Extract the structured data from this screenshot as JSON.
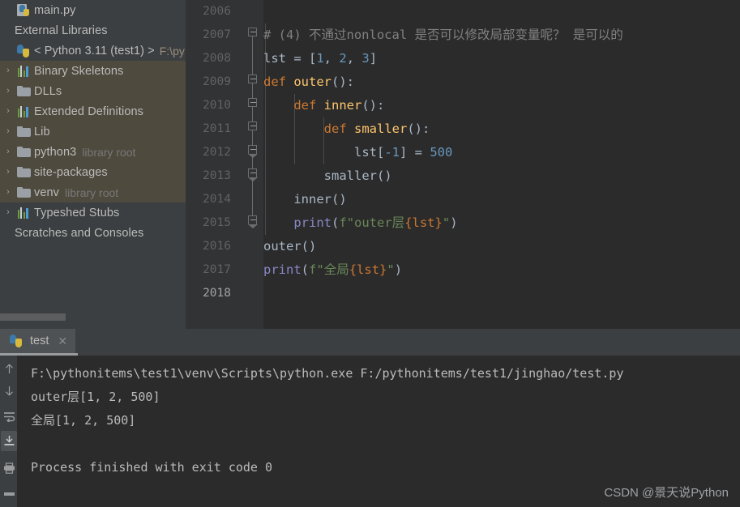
{
  "project_panel": {
    "items": [
      {
        "arrow": "",
        "icon": "python-file-icon",
        "label": "main.py",
        "suffix": "",
        "selected": false,
        "indent": 0
      },
      {
        "arrow": "",
        "icon": "none",
        "label": "External Libraries",
        "suffix": "",
        "selected": false,
        "indent": 0
      },
      {
        "arrow": "",
        "icon": "python-icon",
        "label": "< Python 3.11 (test1) >",
        "suffix": "F:\\py",
        "selected": false,
        "indent": 0
      },
      {
        "arrow": "›",
        "icon": "bars-icon",
        "label": "Binary Skeletons",
        "suffix": "",
        "selected": true,
        "indent": 1
      },
      {
        "arrow": "›",
        "icon": "folder-icon",
        "label": "DLLs",
        "suffix": "",
        "selected": true,
        "indent": 1
      },
      {
        "arrow": "›",
        "icon": "bars-icon",
        "label": "Extended Definitions",
        "suffix": "",
        "selected": true,
        "indent": 1
      },
      {
        "arrow": "›",
        "icon": "folder-icon",
        "label": "Lib",
        "suffix": "",
        "selected": true,
        "indent": 1
      },
      {
        "arrow": "›",
        "icon": "folder-icon",
        "label": "python3",
        "suffix": "library root",
        "selected": true,
        "indent": 1
      },
      {
        "arrow": "›",
        "icon": "folder-icon",
        "label": "site-packages",
        "suffix": "",
        "selected": true,
        "indent": 1
      },
      {
        "arrow": "›",
        "icon": "folder-icon",
        "label": "venv",
        "suffix": "library root",
        "selected": true,
        "indent": 1
      },
      {
        "arrow": "›",
        "icon": "bars-icon",
        "label": "Typeshed Stubs",
        "suffix": "",
        "selected": false,
        "indent": 1
      },
      {
        "arrow": "",
        "icon": "none",
        "label": "Scratches and Consoles",
        "suffix": "",
        "selected": false,
        "indent": 0
      }
    ]
  },
  "editor": {
    "first_line_number": 2006,
    "current_line_number": 2018,
    "lines": [
      {
        "n": "2006",
        "text": ""
      },
      {
        "n": "2007",
        "text": "# (4) 不通过nonlocal 是否可以修改局部变量呢？ 是可以的"
      },
      {
        "n": "2008",
        "text": "lst = [1, 2, 3]"
      },
      {
        "n": "2009",
        "text": "def outer():"
      },
      {
        "n": "2010",
        "text": "    def inner():"
      },
      {
        "n": "2011",
        "text": "        def smaller():"
      },
      {
        "n": "2012",
        "text": "            lst[-1] = 500"
      },
      {
        "n": "2013",
        "text": "        smaller()"
      },
      {
        "n": "2014",
        "text": "    inner()"
      },
      {
        "n": "2015",
        "text": "    print(f\"outer层{lst}\")"
      },
      {
        "n": "2016",
        "text": "outer()"
      },
      {
        "n": "2017",
        "text": "print(f\"全局{lst}\")"
      },
      {
        "n": "2018",
        "text": ""
      }
    ]
  },
  "run_panel": {
    "tab_label": "test",
    "tab_close": "✕",
    "toolbar_icons": [
      "arrow-up-icon",
      "arrow-down-icon",
      "soft-wrap-icon",
      "scroll-to-end-icon",
      "print-icon",
      "clear-all-icon"
    ],
    "console_lines": [
      "F:\\pythonitems\\test1\\venv\\Scripts\\python.exe F:/pythonitems/test1/jinghao/test.py",
      "outer层[1, 2, 500]",
      "全局[1, 2, 500]",
      "",
      "Process finished with exit code 0"
    ]
  },
  "watermark": "CSDN @景天说Python",
  "colors": {
    "editor_bg": "#2B2B2B",
    "panel_bg": "#3C3F41",
    "gutter_bg": "#313335",
    "selection": "#4E4A3E",
    "keyword": "#CC7832",
    "function": "#FFC66D",
    "number": "#6897BB",
    "string": "#6A8759",
    "comment": "#808080",
    "builtin": "#8888C6",
    "plain_text": "#A9B7C6"
  }
}
